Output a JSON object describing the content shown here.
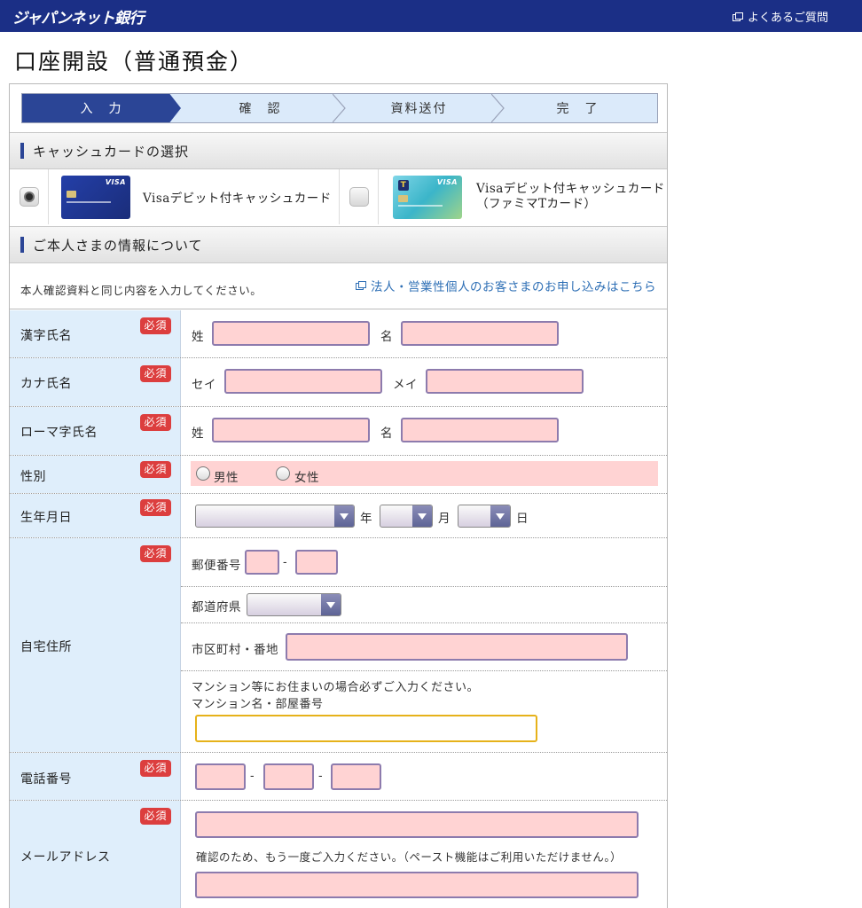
{
  "header": {
    "logo": "ジャパンネット銀行",
    "faq_label": "よくあるご質問"
  },
  "page": {
    "title": "口座開設（普通預金）"
  },
  "steps": [
    "入　力",
    "確　認",
    "資料送付",
    "完　了"
  ],
  "card_section": {
    "title": "キャッシュカードの選択",
    "options": [
      {
        "label": "Visaデビット付キャッシュカード",
        "selected": true,
        "card_brand": "VISA"
      },
      {
        "label_line1": "Visaデビット付キャッシュカード",
        "label_line2": "（ファミマTカード）",
        "selected": false,
        "card_brand": "VISA"
      }
    ]
  },
  "personal_section": {
    "title": "ご本人さまの情報について",
    "intro": "本人確認資料と同じ内容を入力してください。",
    "corporate_link": "法人・営業性個人のお客さまのお申し込みはこちら"
  },
  "required_label": "必須",
  "fields": {
    "kanji_name": {
      "label": "漢字氏名",
      "first": "姓",
      "second": "名"
    },
    "kana_name": {
      "label": "カナ氏名",
      "first": "セイ",
      "second": "メイ"
    },
    "roman_name": {
      "label": "ローマ字氏名",
      "first": "姓",
      "second": "名"
    },
    "gender": {
      "label": "性別",
      "male": "男性",
      "female": "女性"
    },
    "birthday": {
      "label": "生年月日",
      "year": "年",
      "month": "月",
      "day": "日"
    },
    "address": {
      "label": "自宅住所",
      "postal": "郵便番号",
      "dash": "-",
      "prefecture": "都道府県",
      "city": "市区町村・番地",
      "note": "マンション等にお住まいの場合必ずご入力ください。",
      "building": "マンション名・部屋番号"
    },
    "phone": {
      "label": "電話番号",
      "dash": "-"
    },
    "email": {
      "label": "メールアドレス",
      "confirm_note": "確認のため、もう一度ご入力ください。（ペースト機能はご利用いただけません。）"
    }
  },
  "colors": {
    "header_bg": "#1b2f86",
    "step_active": "#2b4596",
    "required": "#dc3e3e",
    "label_bg": "#dfeefb",
    "input_bg": "#ffd3d3"
  }
}
